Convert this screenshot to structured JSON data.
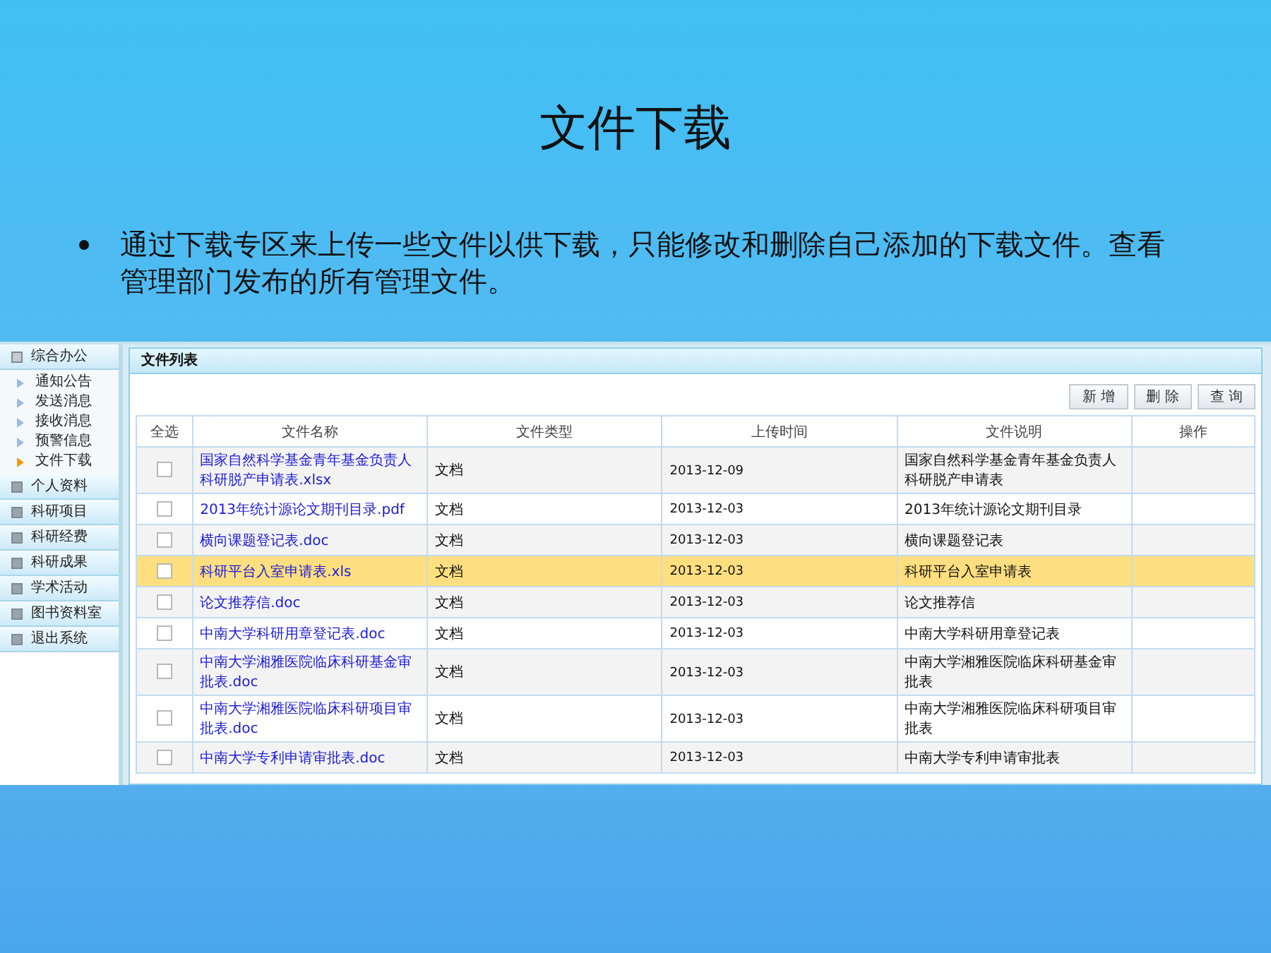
{
  "slide": {
    "title": "文件下载",
    "bullet": "通过下载专区来上传一些文件以供下载，只能修改和删除自己添加的下载文件。查看管理部门发布的所有管理文件。"
  },
  "sidebar": {
    "groups": [
      {
        "label": "综合办公",
        "expanded": true,
        "children": [
          {
            "label": "通知公告",
            "selected": false
          },
          {
            "label": "发送消息",
            "selected": false
          },
          {
            "label": "接收消息",
            "selected": false
          },
          {
            "label": "预警信息",
            "selected": false
          },
          {
            "label": "文件下载",
            "selected": true
          }
        ]
      },
      {
        "label": "个人资料",
        "expanded": false
      },
      {
        "label": "科研项目",
        "expanded": false
      },
      {
        "label": "科研经费",
        "expanded": false
      },
      {
        "label": "科研成果",
        "expanded": false
      },
      {
        "label": "学术活动",
        "expanded": false
      },
      {
        "label": "图书资料室",
        "expanded": false
      },
      {
        "label": "退出系统",
        "expanded": false
      }
    ]
  },
  "panel": {
    "title": "文件列表",
    "buttons": [
      "新 增",
      "删 除",
      "查 询"
    ]
  },
  "table": {
    "columns": [
      "全选",
      "文件名称",
      "文件类型",
      "上传时间",
      "文件说明",
      "操作"
    ],
    "rows": [
      {
        "checked": false,
        "selected": false,
        "name": "国家自然科学基金青年基金负责人科研脱产申请表.xlsx",
        "type": "文档",
        "date": "2013-12-09",
        "desc": "国家自然科学基金青年基金负责人科研脱产申请表"
      },
      {
        "checked": false,
        "selected": false,
        "name": "2013年统计源论文期刊目录.pdf",
        "type": "文档",
        "date": "2013-12-03",
        "desc": "2013年统计源论文期刊目录"
      },
      {
        "checked": false,
        "selected": false,
        "name": "横向课题登记表.doc",
        "type": "文档",
        "date": "2013-12-03",
        "desc": "横向课题登记表"
      },
      {
        "checked": false,
        "selected": true,
        "name": "科研平台入室申请表.xls",
        "type": "文档",
        "date": "2013-12-03",
        "desc": "科研平台入室申请表"
      },
      {
        "checked": false,
        "selected": false,
        "name": "论文推荐信.doc",
        "type": "文档",
        "date": "2013-12-03",
        "desc": "论文推荐信"
      },
      {
        "checked": false,
        "selected": false,
        "name": "中南大学科研用章登记表.doc",
        "type": "文档",
        "date": "2013-12-03",
        "desc": "中南大学科研用章登记表"
      },
      {
        "checked": false,
        "selected": false,
        "name": "中南大学湘雅医院临床科研基金审批表.doc",
        "type": "文档",
        "date": "2013-12-03",
        "desc": "中南大学湘雅医院临床科研基金审批表"
      },
      {
        "checked": false,
        "selected": false,
        "name": "中南大学湘雅医院临床科研项目审批表.doc",
        "type": "文档",
        "date": "2013-12-03",
        "desc": "中南大学湘雅医院临床科研项目审批表"
      },
      {
        "checked": false,
        "selected": false,
        "name": "中南大学专利申请审批表.doc",
        "type": "文档",
        "date": "2013-12-03",
        "desc": "中南大学专利申请审批表"
      }
    ]
  }
}
